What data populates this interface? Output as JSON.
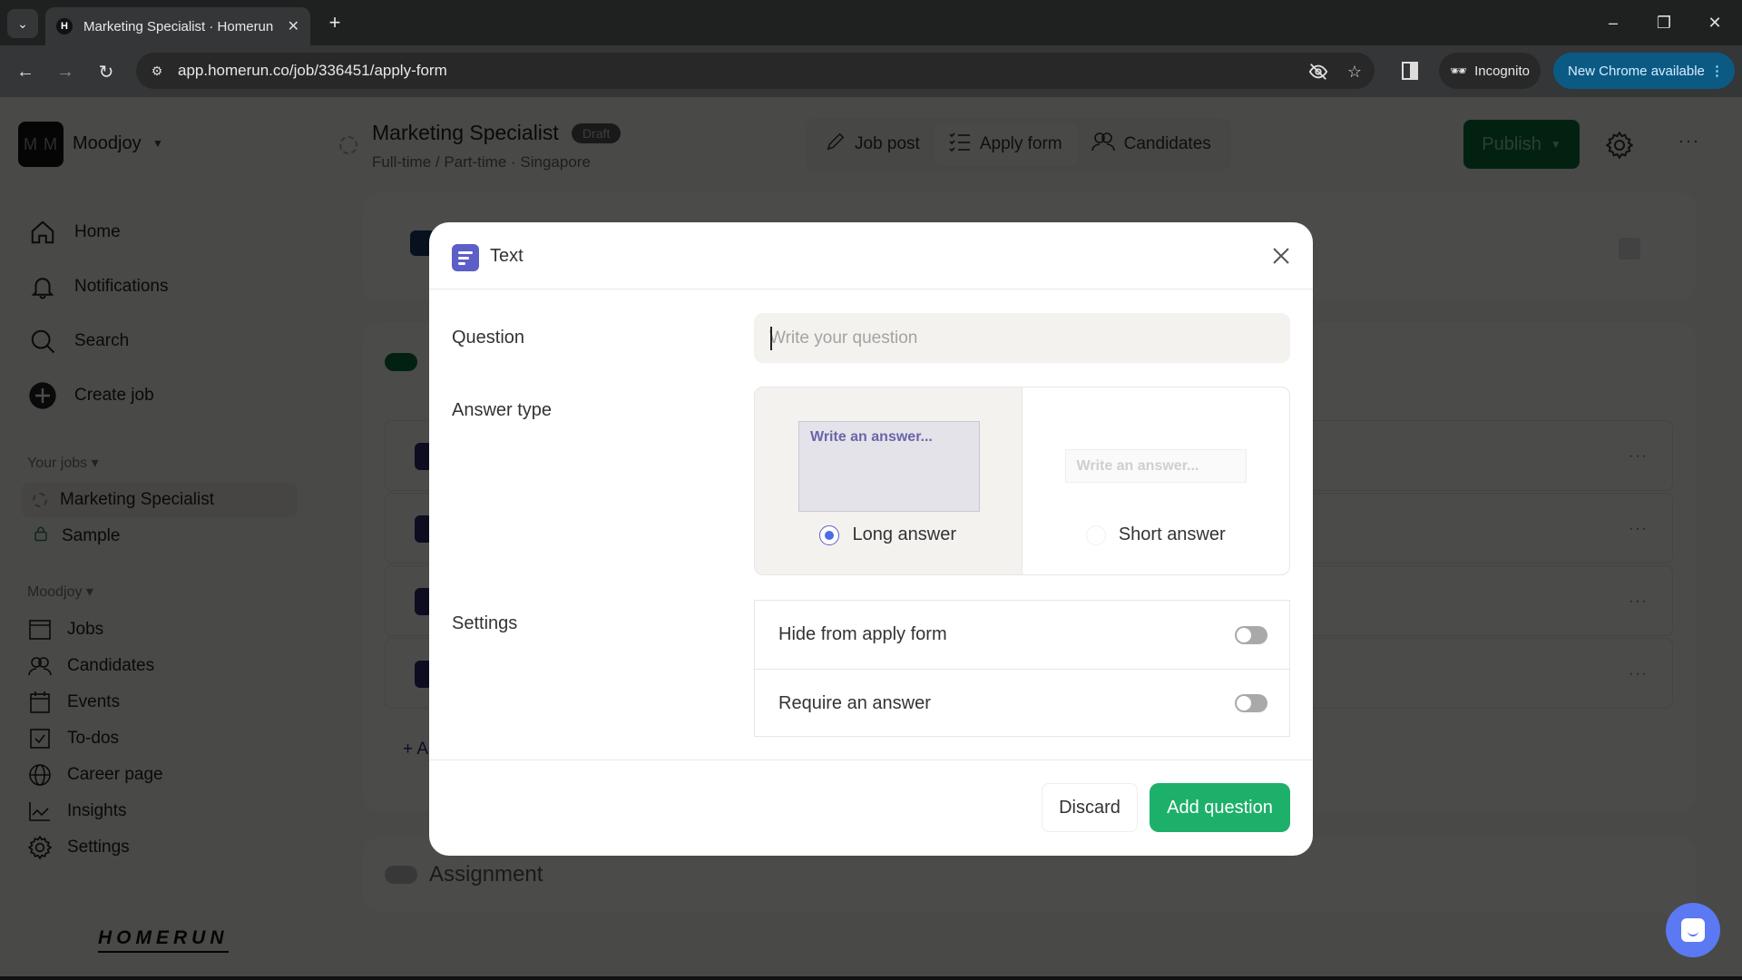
{
  "browser": {
    "tab_title": "Marketing Specialist · Homerun",
    "favicon_letter": "H",
    "url": "app.homerun.co/job/336451/apply-form",
    "incognito_label": "Incognito",
    "update_label": "New Chrome available"
  },
  "workspace": {
    "initials": "M M",
    "name": "Moodjoy"
  },
  "sidebar": {
    "main_nav": [
      {
        "label": "Home",
        "icon": "home-icon"
      },
      {
        "label": "Notifications",
        "icon": "bell-icon"
      },
      {
        "label": "Search",
        "icon": "search-icon"
      },
      {
        "label": "Create job",
        "icon": "plus-circle-icon"
      }
    ],
    "your_jobs_label": "Your jobs",
    "jobs": [
      {
        "label": "Marketing Specialist",
        "icon": "draft-circle-icon",
        "active": true
      },
      {
        "label": "Sample",
        "icon": "lock-icon",
        "active": false
      }
    ],
    "org_label": "Moodjoy",
    "org_nav": [
      {
        "label": "Jobs",
        "icon": "jobs-icon"
      },
      {
        "label": "Candidates",
        "icon": "people-icon"
      },
      {
        "label": "Events",
        "icon": "calendar-icon"
      },
      {
        "label": "To-dos",
        "icon": "checkbox-icon"
      },
      {
        "label": "Career page",
        "icon": "globe-icon"
      },
      {
        "label": "Insights",
        "icon": "chart-icon"
      },
      {
        "label": "Settings",
        "icon": "gear-icon"
      }
    ],
    "logo_text": "HOMERUN"
  },
  "header": {
    "job_title": "Marketing Specialist",
    "status_badge": "Draft",
    "job_subtitle": "Full-time / Part-time · Singapore",
    "tabs": [
      {
        "label": "Job post",
        "icon": "pencil-icon",
        "active": false
      },
      {
        "label": "Apply form",
        "icon": "checklist-icon",
        "active": true
      },
      {
        "label": "Candidates",
        "icon": "people-icon",
        "active": false
      }
    ],
    "publish_label": "Publish"
  },
  "background": {
    "assignment_label": "Assignment",
    "add_label": "+ A"
  },
  "modal": {
    "title": "Text",
    "question_label": "Question",
    "question_value": "",
    "question_placeholder": "Write your question",
    "answer_type_label": "Answer type",
    "answer_options": [
      {
        "label": "Long answer",
        "preview": "Write an answer...",
        "selected": true
      },
      {
        "label": "Short answer",
        "preview": "Write an answer...",
        "selected": false
      }
    ],
    "settings_label": "Settings",
    "settings": [
      {
        "label": "Hide from apply form",
        "enabled": false
      },
      {
        "label": "Require an answer",
        "enabled": false
      }
    ],
    "discard_label": "Discard",
    "add_label": "Add question"
  },
  "colors": {
    "accent_green": "#1db06a",
    "accent_purple": "#5b5fc7",
    "radio_blue": "#4f6be8",
    "chat_blue": "#5b79f2"
  }
}
